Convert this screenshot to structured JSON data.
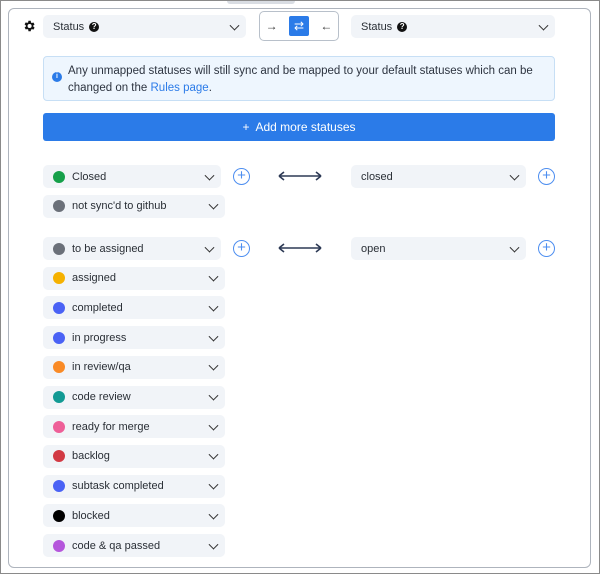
{
  "header": {
    "left_field": {
      "label": "Status",
      "help_icon": "question-icon"
    },
    "right_field": {
      "label": "Status",
      "help_icon": "question-icon"
    },
    "direction": {
      "options": [
        "→",
        "⇄",
        "←"
      ],
      "active": 1
    }
  },
  "info": {
    "text": "Any unmapped statuses will still sync and be mapped to your default statuses which can be changed on the ",
    "link": "Rules page",
    "suffix": "."
  },
  "add_button": {
    "icon": "+",
    "label": "Add more statuses"
  },
  "colors": {
    "accent": "#2b7be8"
  },
  "mappings": [
    {
      "left": [
        {
          "label": "Closed",
          "color": "#16a04a"
        },
        {
          "label": "not sync'd to github",
          "color": "#6b7079"
        }
      ],
      "right": "closed"
    },
    {
      "left": [
        {
          "label": "to be assigned",
          "color": "#6b7079"
        },
        {
          "label": "assigned",
          "color": "#f5b100"
        },
        {
          "label": "completed",
          "color": "#4a62f5"
        },
        {
          "label": "in progress",
          "color": "#4a62f5"
        },
        {
          "label": "in review/qa",
          "color": "#f98a26"
        },
        {
          "label": "code review",
          "color": "#129a94"
        },
        {
          "label": "ready for merge",
          "color": "#ee5f98"
        },
        {
          "label": "backlog",
          "color": "#d23a44"
        },
        {
          "label": "subtask completed",
          "color": "#4a62f5"
        },
        {
          "label": "blocked",
          "color": "#000000"
        },
        {
          "label": "code & qa passed",
          "color": "#b556dc"
        }
      ],
      "right": "open"
    }
  ]
}
